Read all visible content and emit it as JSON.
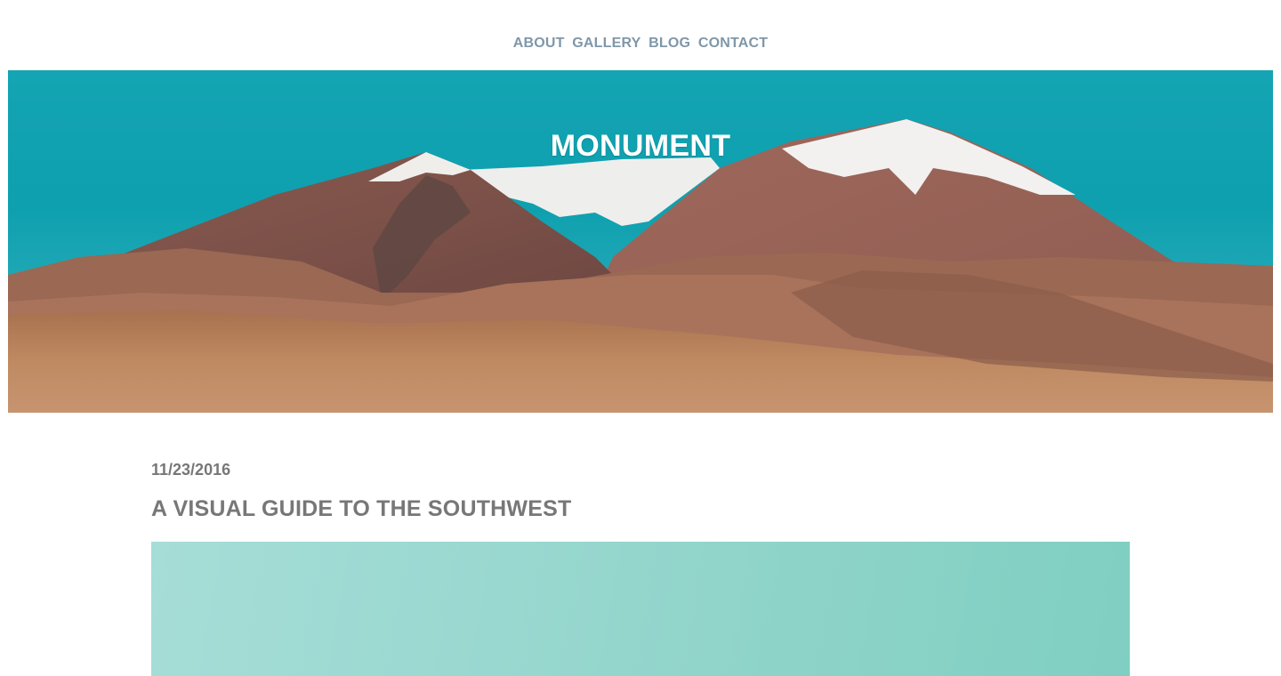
{
  "nav": {
    "items": [
      {
        "label": "ABOUT"
      },
      {
        "label": "GALLERY"
      },
      {
        "label": "BLOG"
      },
      {
        "label": "CONTACT"
      }
    ]
  },
  "hero": {
    "title": "MONUMENT",
    "sky_color": "#14a4b3",
    "ground_color": "#b98060"
  },
  "post": {
    "date": "11/23/2016",
    "title": "A VISUAL GUIDE TO THE SOUTHWEST",
    "image_color": "#8ed3c8"
  }
}
